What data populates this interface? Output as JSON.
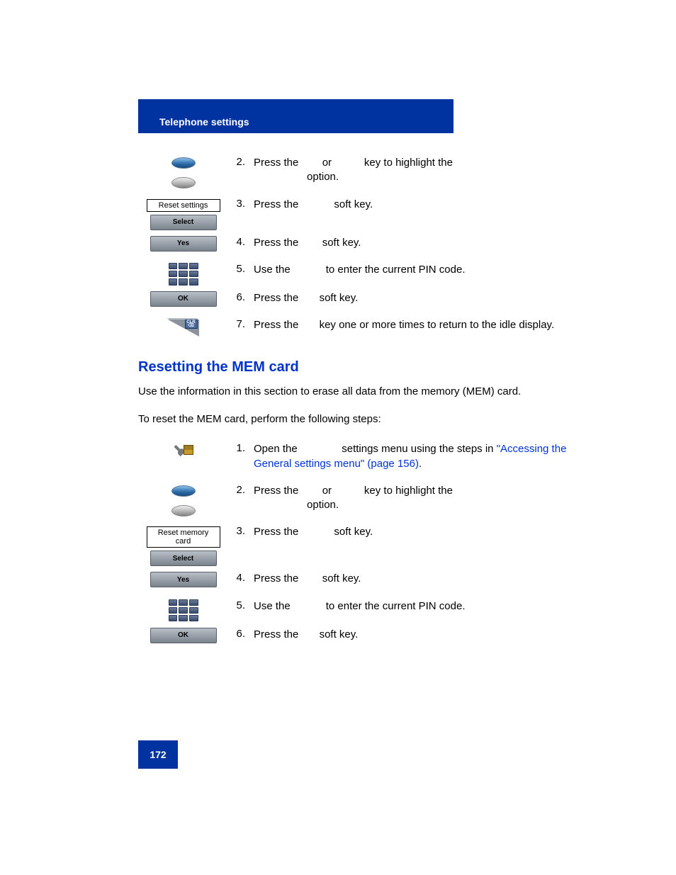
{
  "header": {
    "title": "Telephone settings"
  },
  "section1": {
    "steps": [
      {
        "num": "2.",
        "icon": "nav-up-down",
        "text_parts": [
          "Press the",
          "or",
          "key to highlight the",
          "option."
        ],
        "boldHints": [
          "Up",
          "Down",
          "Reset settings"
        ]
      },
      {
        "num": "3.",
        "icon": "reset-settings-select",
        "icon_label": "Reset settings",
        "icon_soft": "Select",
        "text_parts": [
          "Press the",
          "soft key."
        ],
        "boldHints": [
          "Select"
        ]
      },
      {
        "num": "4.",
        "icon": "yes-softkey",
        "icon_soft": "Yes",
        "text_parts": [
          "Press the",
          "soft key."
        ],
        "boldHints": [
          "Yes"
        ]
      },
      {
        "num": "5.",
        "icon": "dialpad",
        "text_parts": [
          "Use the",
          "to enter the current PIN code."
        ],
        "boldHints": [
          "Dialpad"
        ]
      },
      {
        "num": "6.",
        "icon": "ok-softkey",
        "icon_soft": "OK",
        "text_parts": [
          "Press the",
          "soft key."
        ],
        "boldHints": [
          "OK"
        ]
      },
      {
        "num": "7.",
        "icon": "clr-key",
        "text_parts": [
          "Press the",
          "key one or more times to return to the idle display."
        ],
        "boldHints": [
          "Clr"
        ]
      }
    ]
  },
  "section2": {
    "heading": "Resetting the MEM card",
    "para1": "Use the information in this section to erase all data from the memory (MEM) card.",
    "para2": "To reset the MEM card, perform the following steps:",
    "link": "\"Accessing the General settings menu\" (page 156)",
    "steps": [
      {
        "num": "1.",
        "icon": "tool-icon",
        "text_parts": [
          "Open the",
          "settings menu using the steps in"
        ],
        "boldHints": [
          "General"
        ],
        "append_link": true
      },
      {
        "num": "2.",
        "icon": "nav-up-down",
        "text_parts": [
          "Press the",
          "or",
          "key to highlight the",
          "option."
        ],
        "boldHints": [
          "Up",
          "Down",
          "Reset memory card"
        ]
      },
      {
        "num": "3.",
        "icon": "reset-memcard-select",
        "icon_label": "Reset memory card",
        "icon_soft": "Select",
        "text_parts": [
          "Press the",
          "soft key."
        ],
        "boldHints": [
          "Select"
        ]
      },
      {
        "num": "4.",
        "icon": "yes-softkey",
        "icon_soft": "Yes",
        "text_parts": [
          "Press the",
          "soft key."
        ],
        "boldHints": [
          "Yes"
        ]
      },
      {
        "num": "5.",
        "icon": "dialpad",
        "text_parts": [
          "Use the",
          "to enter the current PIN code."
        ],
        "boldHints": [
          "Dialpad"
        ]
      },
      {
        "num": "6.",
        "icon": "ok-softkey",
        "icon_soft": "OK",
        "text_parts": [
          "Press the",
          "soft key."
        ],
        "boldHints": [
          "OK"
        ]
      }
    ]
  },
  "footer": {
    "page": "172"
  }
}
